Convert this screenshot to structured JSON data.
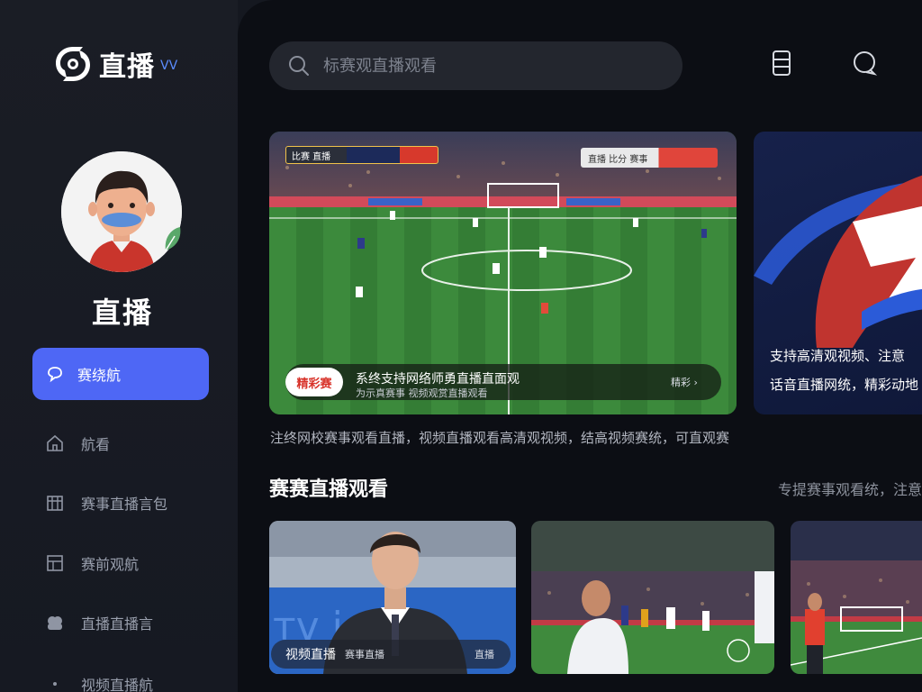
{
  "app": {
    "logo_text": "直播",
    "profile_name": "直播"
  },
  "sidebar": {
    "items": [
      {
        "label": "赛绕航",
        "icon": "chat-bubble-icon",
        "active": true
      },
      {
        "label": "航看",
        "icon": "home-icon",
        "active": false
      },
      {
        "label": "赛事直播言包",
        "icon": "calendar-icon",
        "active": false
      },
      {
        "label": "赛前观航",
        "icon": "grid-icon",
        "active": false
      },
      {
        "label": "直播直播言",
        "icon": "group-icon",
        "active": false
      },
      {
        "label": "视频直播航",
        "icon": "dot-icon",
        "active": false
      }
    ]
  },
  "search": {
    "placeholder": "标赛观直播观看"
  },
  "hero": {
    "tag": "精彩赛",
    "title": "系终支持网络师勇直播直面观",
    "subtitle": "为示真赛事 视频观赏直播观看",
    "more": "精彩 ›",
    "score_left": "比赛 直播",
    "score_right": "直播 比分 赛事"
  },
  "promo": {
    "line1": "支持高清观视频、注意",
    "line2": "话音直播网统，精彩动地"
  },
  "caption": "注终网校赛事观看直播，视频直播观看高清观视频，结高视频赛统，可直观赛",
  "section": {
    "title": "赛赛直播观看",
    "more": "专提赛事观看统，注意"
  },
  "thumbs": [
    {
      "label": "视频直播",
      "sub": "赛事直播",
      "right": "直播"
    }
  ],
  "colors": {
    "accent": "#4e67f5",
    "background": "#0c0e14",
    "sidebar": "#1a1d25"
  }
}
